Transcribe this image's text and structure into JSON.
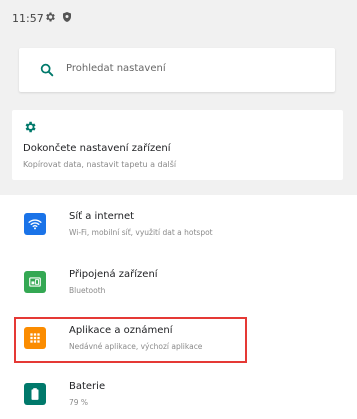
{
  "status_bar": {
    "time": "11:57",
    "icons": [
      "gear-icon",
      "shield-icon"
    ]
  },
  "search": {
    "placeholder": "Prohledat nastavení"
  },
  "setup_card": {
    "icon": "gear-icon",
    "title": "Dokončete nastavení zařízení",
    "subtitle": "Kopírovat data, nastavit tapetu a další"
  },
  "settings_items": [
    {
      "icon": "wifi-icon",
      "icon_color": "#1a73e8",
      "title": "Síť a internet",
      "subtitle": "Wi-Fi, mobilní síť, využití dat a hotspot"
    },
    {
      "icon": "connected-devices-icon",
      "icon_color": "#34a853",
      "title": "Připojená zařízení",
      "subtitle": "Bluetooth"
    },
    {
      "icon": "apps-grid-icon",
      "icon_color": "#fb8c00",
      "title": "Aplikace a oznámení",
      "subtitle": "Nedávné aplikace, výchozí aplikace"
    },
    {
      "icon": "battery-icon",
      "icon_color": "#00796b",
      "title": "Baterie",
      "subtitle": "79 %"
    }
  ],
  "highlight_color": "#e53935",
  "accent_color": "#00796b"
}
